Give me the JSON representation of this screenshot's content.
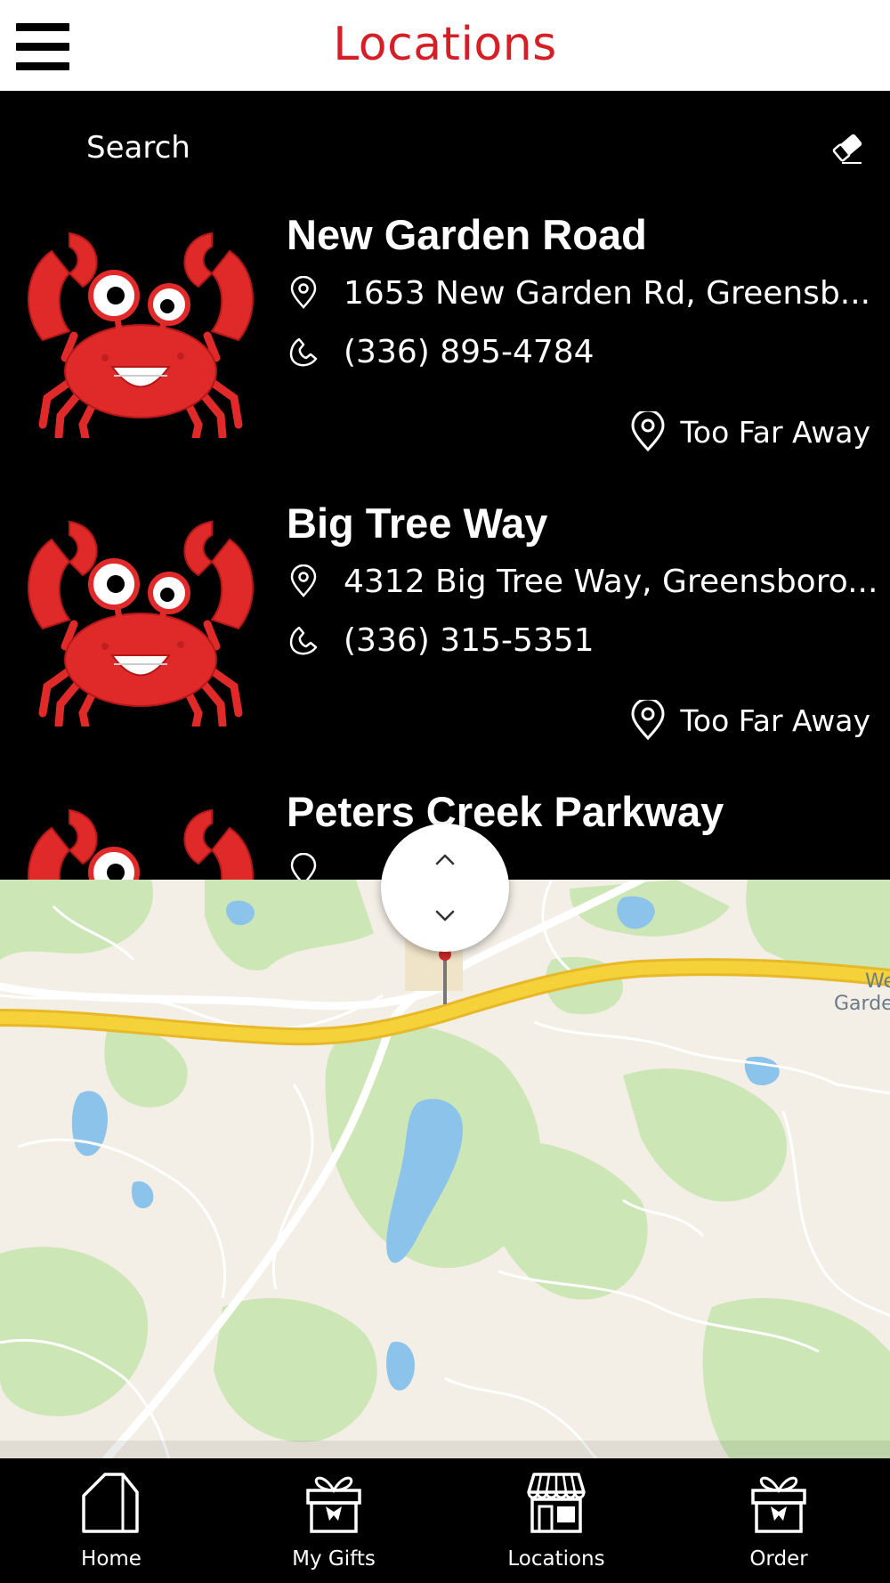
{
  "header": {
    "title": "Locations",
    "menu_icon": "hamburger-menu-icon"
  },
  "search": {
    "label": "Search",
    "clear_icon": "eraser-icon"
  },
  "locations": [
    {
      "name": "New Garden Road",
      "address": "1653 New Garden Rd, Greensb...",
      "phone": "(336) 895-4784",
      "distance": "Too Far Away"
    },
    {
      "name": "Big Tree Way",
      "address": "4312 Big Tree Way, Greensboro...",
      "phone": "(336) 315-5351",
      "distance": "Too Far Away"
    },
    {
      "name": "Peters Creek Parkway"
    }
  ],
  "map": {
    "label_line1": "We",
    "label_line2": "Garde",
    "toggle_icons": [
      "chevron-up-icon",
      "chevron-down-icon"
    ]
  },
  "nav": [
    {
      "label": "Home",
      "icon": "home-icon"
    },
    {
      "label": "My Gifts",
      "icon": "gift-icon"
    },
    {
      "label": "Locations",
      "icon": "store-icon"
    },
    {
      "label": "Order",
      "icon": "gift-icon"
    }
  ],
  "colors": {
    "accent": "#d51f26",
    "background": "#000000",
    "crab": "#e02a2a",
    "highway": "#f5d13a"
  }
}
